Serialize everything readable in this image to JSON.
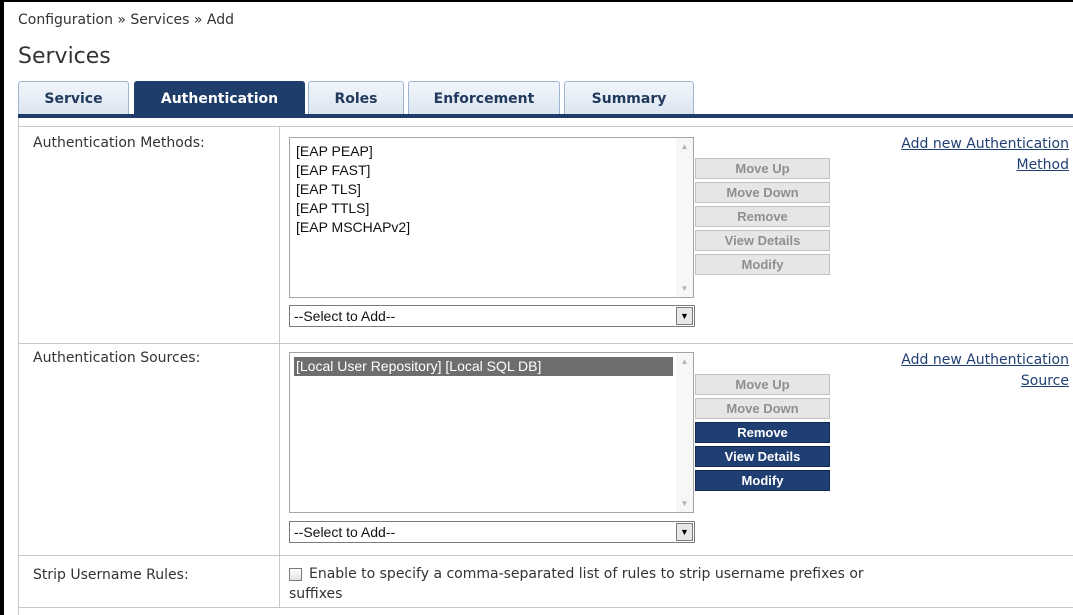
{
  "breadcrumb": "Configuration » Services » Add",
  "page_title": "Services",
  "tabs": [
    {
      "label": "Service",
      "active": false
    },
    {
      "label": "Authentication",
      "active": true
    },
    {
      "label": "Roles",
      "active": false
    },
    {
      "label": "Enforcement",
      "active": false
    },
    {
      "label": "Summary",
      "active": false
    }
  ],
  "auth_methods": {
    "label": "Authentication Methods:",
    "items": [
      "[EAP PEAP]",
      "[EAP FAST]",
      "[EAP TLS]",
      "[EAP TTLS]",
      "[EAP MSCHAPv2]"
    ],
    "select_placeholder": "--Select to Add--",
    "buttons": {
      "move_up": "Move Up",
      "move_down": "Move Down",
      "remove": "Remove",
      "view_details": "View Details",
      "modify": "Modify"
    },
    "add_link_line1": "Add new Authentication",
    "add_link_line2": "Method"
  },
  "auth_sources": {
    "label": "Authentication Sources:",
    "items": [
      "[Local User Repository] [Local SQL DB]"
    ],
    "select_placeholder": "--Select to Add--",
    "buttons": {
      "move_up": "Move Up",
      "move_down": "Move Down",
      "remove": "Remove",
      "view_details": "View Details",
      "modify": "Modify"
    },
    "add_link_line1": "Add new Authentication",
    "add_link_line2": "Source"
  },
  "strip_username": {
    "label": "Strip Username Rules:",
    "checkbox_text_line1": "Enable to specify a comma-separated list of rules to strip username prefixes or",
    "checkbox_text_line2": "suffixes",
    "checked": false
  },
  "colors": {
    "accent": "#1e3d6b",
    "link": "#1f3f73",
    "disabled_button": "#e6e6e6"
  }
}
